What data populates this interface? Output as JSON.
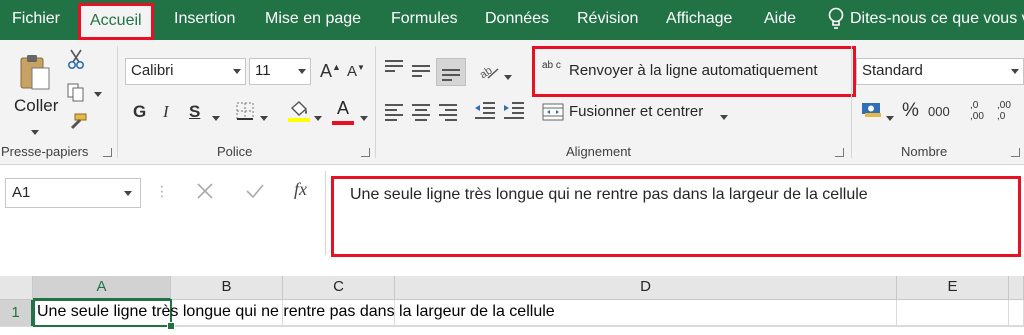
{
  "tabs": [
    "Fichier",
    "Accueil",
    "Insertion",
    "Mise en page",
    "Formules",
    "Données",
    "Révision",
    "Affichage",
    "Aide"
  ],
  "tell_me": "Dites-nous ce que vous v",
  "clipboard": {
    "paste_label": "Coller",
    "group_label": "Presse-papiers"
  },
  "font": {
    "name": "Calibri",
    "size": "11",
    "bold": "G",
    "italic": "I",
    "underline": "S",
    "grow": "A",
    "shrink": "A",
    "font_color_letter": "A",
    "group_label": "Police"
  },
  "alignment": {
    "wrap_text": "Renvoyer à la ligne automatiquement",
    "merge_center": "Fusionner et centrer",
    "group_label": "Alignement",
    "wrap_icon_text": "ab c"
  },
  "number": {
    "format": "Standard",
    "percent": "%",
    "thousands": "000",
    "inc_dec": ",0 ,00",
    "dec_dec": ",00 ,0",
    "group_label": "Nombre"
  },
  "name_box": "A1",
  "fx": "fx",
  "formula_content": "Une seule ligne très longue qui ne rentre pas dans la largeur de la cellule",
  "columns": [
    "A",
    "B",
    "C",
    "D",
    "E"
  ],
  "row_number": "1",
  "cell_a1_text": "Une seule ligne très longue qui ne rentre pas dans la largeur de la cellule",
  "colors": {
    "accent": "#217346",
    "highlight_red": "#e81123",
    "fill_yellow": "#ffff00",
    "font_red": "#e81123"
  }
}
